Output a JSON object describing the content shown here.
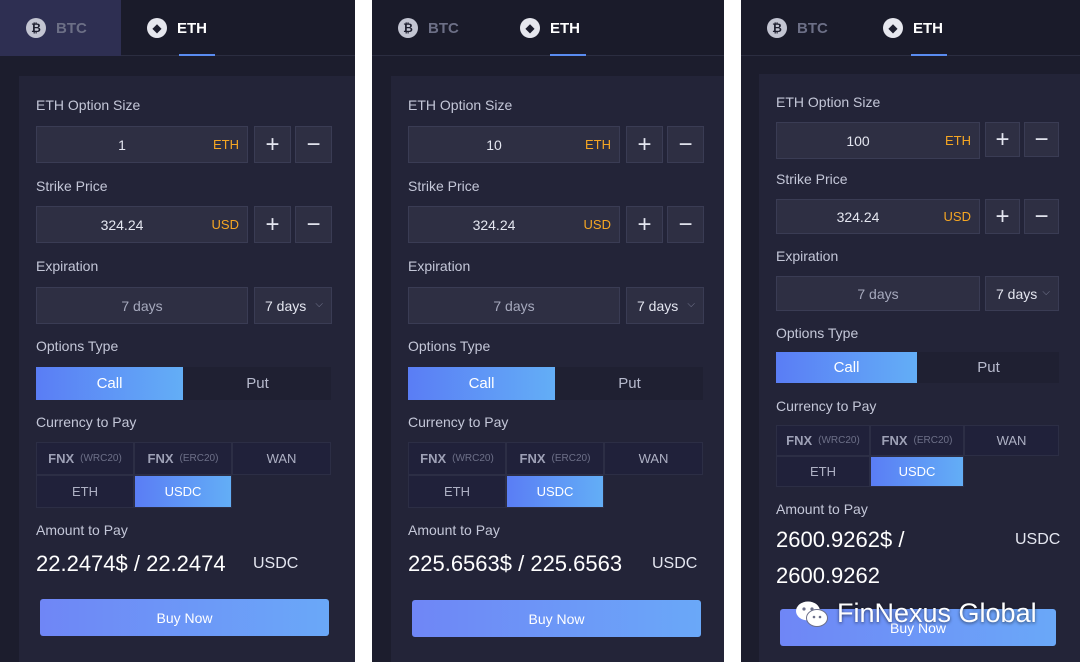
{
  "tabs": {
    "btc": "BTC",
    "eth": "ETH"
  },
  "labels": {
    "option_size": "ETH Option Size",
    "strike_price": "Strike Price",
    "expiration": "Expiration",
    "options_type": "Options Type",
    "currency_to_pay": "Currency to Pay",
    "amount_to_pay": "Amount to Pay"
  },
  "controls": {
    "plus": "+",
    "minus": "−",
    "call": "Call",
    "put": "Put",
    "buy_now": "Buy Now",
    "chevron": "⌵"
  },
  "currencies": {
    "fnx": "FNX",
    "wrc20": "(WRC20)",
    "erc20": "(ERC20)",
    "wan": "WAN",
    "eth": "ETH",
    "usdc": "USDC"
  },
  "panels": [
    {
      "size_value": "1",
      "size_unit": "ETH",
      "strike_value": "324.24",
      "strike_unit": "USD",
      "expiration_value": "7 days",
      "expiration_select": "7 days",
      "amount": "22.2474$ / 22.2474",
      "amount_line2": "",
      "amount_unit": "USDC"
    },
    {
      "size_value": "10",
      "size_unit": "ETH",
      "strike_value": "324.24",
      "strike_unit": "USD",
      "expiration_value": "7 days",
      "expiration_select": "7 days",
      "amount": "225.6563$ / 225.6563",
      "amount_line2": "",
      "amount_unit": "USDC"
    },
    {
      "size_value": "100",
      "size_unit": "ETH",
      "strike_value": "324.24",
      "strike_unit": "USD",
      "expiration_value": "7 days",
      "expiration_select": "7 days",
      "amount": "2600.9262$ /",
      "amount_line2": "2600.9262",
      "amount_unit": "USDC"
    }
  ],
  "watermark": "FinNexus Global",
  "colors": {
    "accent_gradient_start": "#5a7df5",
    "accent_gradient_end": "#63aef6",
    "unit_orange": "#f5a623",
    "panel_bg": "#1c1d2d",
    "card_bg": "#232438"
  }
}
